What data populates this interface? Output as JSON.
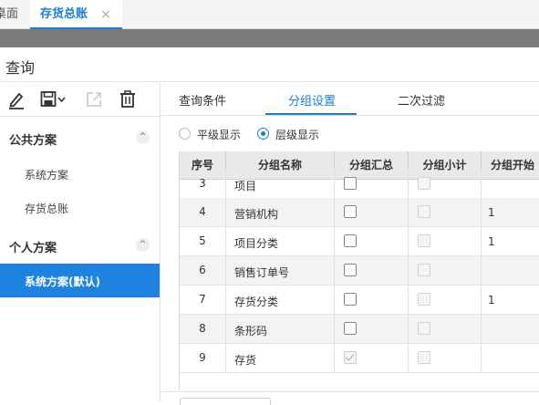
{
  "tabs": {
    "home_label": "桌面",
    "active_label": "存货总账",
    "close_glyph": "×"
  },
  "header": {
    "title": "查询"
  },
  "toolbar": {
    "icons": [
      "edit-icon",
      "save-icon",
      "export-icon",
      "delete-icon"
    ]
  },
  "sidebar": {
    "public_group": "公共方案",
    "public_items": [
      "系统方案",
      "存货总账"
    ],
    "personal_group": "个人方案",
    "personal_items": [
      "系统方案(默认)"
    ],
    "collapse_glyph": "^"
  },
  "panel_tabs": [
    "查询条件",
    "分组设置",
    "二次过滤"
  ],
  "display_mode": {
    "options": [
      "平级显示",
      "层级显示"
    ],
    "selected": "层级显示"
  },
  "grid": {
    "columns": [
      "序号",
      "分组名称",
      "分组汇总",
      "分组小计",
      "分组开始"
    ],
    "rows": [
      {
        "seq": "3",
        "name": "项目",
        "summary": false,
        "subtotal_enabled": false,
        "start": ""
      },
      {
        "seq": "4",
        "name": "营销机构",
        "summary": false,
        "subtotal_enabled": false,
        "start": "1"
      },
      {
        "seq": "5",
        "name": "项目分类",
        "summary": false,
        "subtotal_enabled": false,
        "start": "1"
      },
      {
        "seq": "6",
        "name": "销售订单号",
        "summary": false,
        "subtotal_enabled": false,
        "start": ""
      },
      {
        "seq": "7",
        "name": "存货分类",
        "summary": false,
        "subtotal_enabled": false,
        "start": "1"
      },
      {
        "seq": "8",
        "name": "条形码",
        "summary": false,
        "subtotal_enabled": false,
        "start": ""
      },
      {
        "seq": "9",
        "name": "存货",
        "summary": true,
        "subtotal_enabled": false,
        "start": ""
      }
    ]
  },
  "colors": {
    "accent": "#1a7fd4",
    "selected_bg": "#1e83e0",
    "topbar_gray": "#7b7b7b"
  }
}
